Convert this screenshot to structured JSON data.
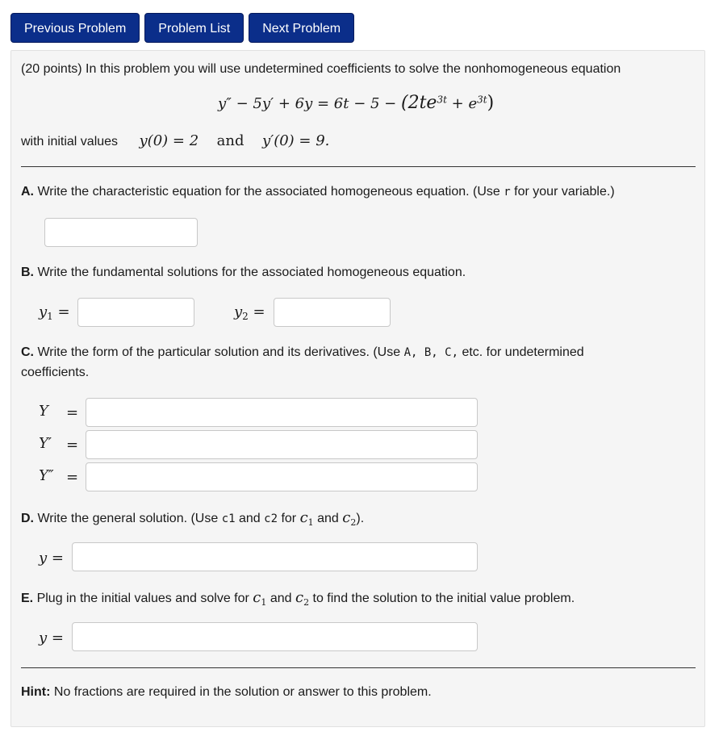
{
  "nav": {
    "previous": "Previous Problem",
    "list": "Problem List",
    "next": "Next Problem"
  },
  "intro": "(20 points) In this problem you will use undetermined coefficients to solve the nonhomogeneous equation",
  "equation": {
    "lhs": "y″ − 5y′ + 6y = 6t − 5 − ",
    "paren": "(2te",
    "exp1": "3t",
    "plus": " + e",
    "exp2": "3t",
    "close": ")"
  },
  "initial": {
    "label": "with initial values",
    "y0": "y(0) = 2",
    "and": "and",
    "yp0": "y′(0) = 9."
  },
  "partA": {
    "letter": "A.",
    "text_before": " Write the characteristic equation for the associated homogeneous equation. (Use ",
    "var": "r",
    "text_after": " for your variable.)"
  },
  "partB": {
    "letter": "B.",
    "text": " Write the fundamental solutions for the associated homogeneous equation.",
    "y1": "y",
    "y1_sub": "1",
    "y2": "y",
    "y2_sub": "2",
    "eq": " ="
  },
  "partC": {
    "letter": "C.",
    "text_before": " Write the form of the particular solution and its derivatives. (Use ",
    "codes": "A, B, C,",
    "text_after": " etc. for undetermined",
    "line2": "coefficients.",
    "Y": "Y",
    "Yp": "Y′",
    "Ypp": "Y″",
    "eq": "="
  },
  "partD": {
    "letter": "D.",
    "text1": " Write the general solution. (Use ",
    "c1code": "c1",
    "and1": " and ",
    "c2code": "c2",
    "for": " for ",
    "c1": "c",
    "c1sub": "1",
    "and2": " and ",
    "c2": "c",
    "c2sub": "2",
    "close": ").",
    "y": "y ="
  },
  "partE": {
    "letter": "E.",
    "text1": " Plug in the initial values and solve for ",
    "c1": "c",
    "c1sub": "1",
    "and": " and ",
    "c2": "c",
    "c2sub": "2",
    "text2": " to find the solution to the initial value problem.",
    "y": "y ="
  },
  "hint": {
    "label": "Hint:",
    "text": " No fractions are required in the solution or answer to this problem."
  }
}
